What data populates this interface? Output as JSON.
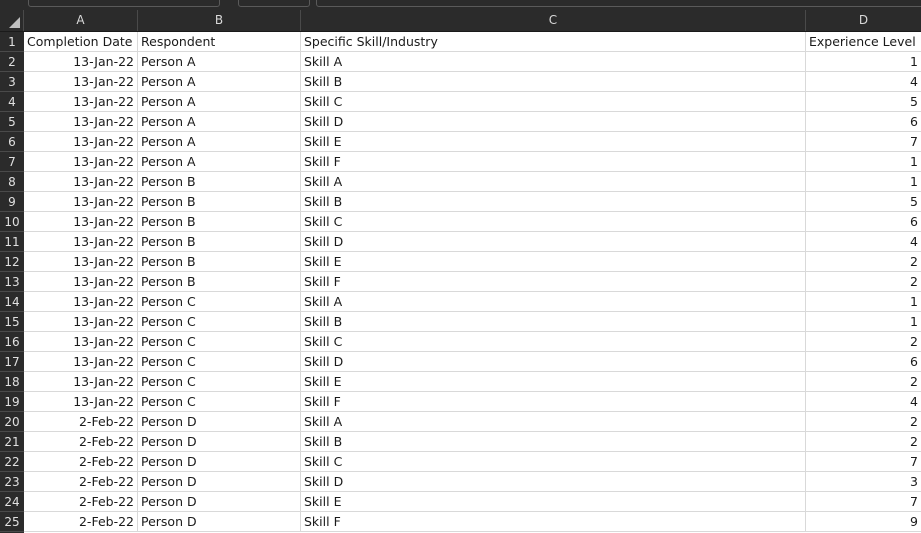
{
  "sheet": {
    "columns": [
      "A",
      "B",
      "C",
      "D"
    ],
    "headers": [
      "Completion Date",
      "Respondent",
      "Specific Skill/Industry",
      "Experience Level"
    ],
    "row_numbers": [
      "1",
      "2",
      "3",
      "4",
      "5",
      "6",
      "7",
      "8",
      "9",
      "10",
      "11",
      "12",
      "13",
      "14",
      "15",
      "16",
      "17",
      "18",
      "19",
      "20",
      "21",
      "22",
      "23",
      "24",
      "25"
    ],
    "rows": [
      [
        "13-Jan-22",
        "Person A",
        "Skill A",
        "1"
      ],
      [
        "13-Jan-22",
        "Person A",
        "Skill B",
        "4"
      ],
      [
        "13-Jan-22",
        "Person A",
        "Skill C",
        "5"
      ],
      [
        "13-Jan-22",
        "Person A",
        "Skill D",
        "6"
      ],
      [
        "13-Jan-22",
        "Person A",
        "Skill E",
        "7"
      ],
      [
        "13-Jan-22",
        "Person A",
        "Skill F",
        "1"
      ],
      [
        "13-Jan-22",
        "Person B",
        "Skill A",
        "1"
      ],
      [
        "13-Jan-22",
        "Person B",
        "Skill B",
        "5"
      ],
      [
        "13-Jan-22",
        "Person B",
        "Skill C",
        "6"
      ],
      [
        "13-Jan-22",
        "Person B",
        "Skill D",
        "4"
      ],
      [
        "13-Jan-22",
        "Person B",
        "Skill E",
        "2"
      ],
      [
        "13-Jan-22",
        "Person B",
        "Skill F",
        "2"
      ],
      [
        "13-Jan-22",
        "Person C",
        "Skill A",
        "1"
      ],
      [
        "13-Jan-22",
        "Person C",
        "Skill B",
        "1"
      ],
      [
        "13-Jan-22",
        "Person C",
        "Skill C",
        "2"
      ],
      [
        "13-Jan-22",
        "Person C",
        "Skill D",
        "6"
      ],
      [
        "13-Jan-22",
        "Person C",
        "Skill E",
        "2"
      ],
      [
        "13-Jan-22",
        "Person C",
        "Skill F",
        "4"
      ],
      [
        "2-Feb-22",
        "Person D",
        "Skill A",
        "2"
      ],
      [
        "2-Feb-22",
        "Person D",
        "Skill B",
        "2"
      ],
      [
        "2-Feb-22",
        "Person D",
        "Skill C",
        "7"
      ],
      [
        "2-Feb-22",
        "Person D",
        "Skill D",
        "3"
      ],
      [
        "2-Feb-22",
        "Person D",
        "Skill E",
        "7"
      ],
      [
        "2-Feb-22",
        "Person D",
        "Skill F",
        "9"
      ]
    ]
  },
  "colors": {
    "chrome": "#2b2b2b",
    "gridline": "#d9d9d9",
    "cell_text": "#1a1a1a",
    "header_text": "#d9d9d9"
  },
  "icons": {
    "corner": "select-all-triangle-icon"
  }
}
